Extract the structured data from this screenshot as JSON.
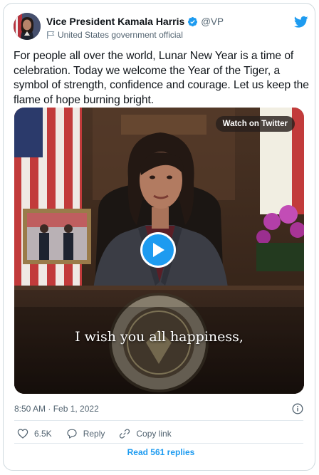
{
  "author": {
    "display_name": "Vice President Kamala Harris",
    "handle": "@VP",
    "label": "United States government official"
  },
  "tweet": {
    "text": "For people all over the world, Lunar New Year is a time of celebration. Today we welcome the Year of the Tiger, a symbol of strength, confidence and courage. Let us keep the flame of hope burning bright."
  },
  "media": {
    "watch_label": "Watch on Twitter",
    "caption": "I wish you all happiness,"
  },
  "meta": {
    "timestamp": "8:50 AM · Feb 1, 2022"
  },
  "actions": {
    "likes_count": "6.5K",
    "reply_label": "Reply",
    "copy_link_label": "Copy link",
    "read_replies_label": "Read 561 replies"
  },
  "colors": {
    "accent": "#1d9bf0",
    "text": "#0f1419",
    "muted": "#536471",
    "border": "#cfd9de"
  },
  "icons": [
    "verified-badge-icon",
    "government-flag-icon",
    "twitter-bird-icon",
    "play-icon",
    "info-icon",
    "heart-icon",
    "reply-icon",
    "link-icon"
  ]
}
